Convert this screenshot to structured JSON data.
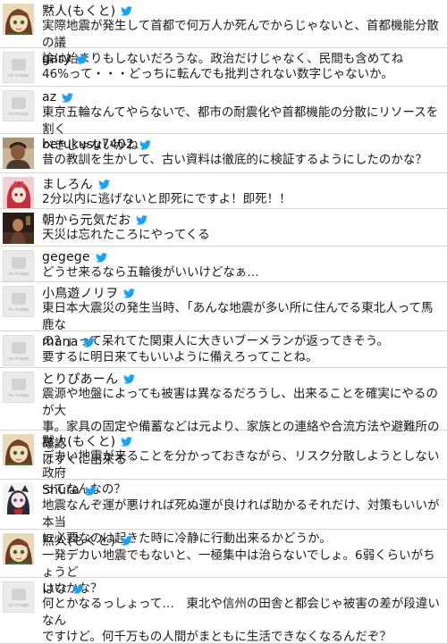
{
  "tweets": [
    {
      "name": "黙人(もくと)",
      "avatar": "anime-girl-avatar",
      "text": "実際地震が発生して首都で何万人か死んでからじゃないと、首都機能分散の議\n論は始まりもしないだろうな。政治だけじゃなく、民間も含めてね"
    },
    {
      "name": "gary",
      "avatar": "no-image-avatar",
      "text": "46%って・・・どっちに転んでも批判されない数字じゃないか。"
    },
    {
      "name": "az",
      "avatar": "no-image-avatar",
      "text": "東京五輪なんてやらないで、都市の耐震化や首都機能の分散にリソースを割く\nべきじゃないかね"
    },
    {
      "name": "berukusu7402",
      "avatar": "portrait-avatar",
      "text": "昔の教訓を生かして、古い資料は徹底的に検証するようにしたのかな？"
    },
    {
      "name": "ましろん",
      "avatar": "red-character-avatar",
      "text": "2分以内に逃げないと即死にですよ！即死！！"
    },
    {
      "name": "朝から元気だお",
      "avatar": "dark-photo-avatar",
      "text": "天災は忘れたころにやってくる"
    },
    {
      "name": "gegege",
      "avatar": "no-image-avatar",
      "text": "どうせ来るなら五輪後がいいけどなぁ…"
    },
    {
      "name": "小鳥遊ノリヲ",
      "avatar": "no-image-avatar",
      "text": "東日本大震災の発生当時、「あんな地震が多い所に住んでる東北人って馬鹿な\nの？」って呆れてた関東人に大きいブーメランが返ってきそう。"
    },
    {
      "name": "mana",
      "avatar": "no-image-avatar",
      "text": "要するに明日来てもいいように備えろってことね。"
    },
    {
      "name": "とりぴあーん",
      "avatar": "no-image-avatar",
      "text": "震源や地盤によっても被害は異なるだろうし、出来ることを確実にやるのが大\n事。家具の固定や備蓄などは元より、家族との連絡や合流方法や避難所の確認\nはすぐに出来る"
    },
    {
      "name": "黙人(もくと)",
      "avatar": "anime-girl-avatar",
      "text": "デカい地震が来ることを分かっておきながら、リスク分散しようとしない政府\nってなんなの？"
    },
    {
      "name": "Shura",
      "avatar": "cat-girl-avatar",
      "text": "地震なんぞ運が悪ければ死ぬ運が良ければ助かるそれだけ、対策もいいが本当\nに必要なのは起きた時に冷静に行動出来るかどうか。"
    },
    {
      "name": "黙人(もくと)",
      "avatar": "anime-girl-avatar",
      "text": "一発デカい地震でもないと、一極集中は治らないでしょ。6弱くらいがちょうど\nいいかな？"
    },
    {
      "name": "はな",
      "avatar": "no-image-avatar",
      "text": "何とかなるっしょって…　東北や信州の田舎と都会じゃ被害の差が段違いなん\nですけど。何千万もの人間がまともに生活できなくなるんだぞ？"
    }
  ],
  "no_image_label": "no image",
  "colors": {
    "twitter_blue": "#1da1f2",
    "divider": "#d6d6d6"
  }
}
